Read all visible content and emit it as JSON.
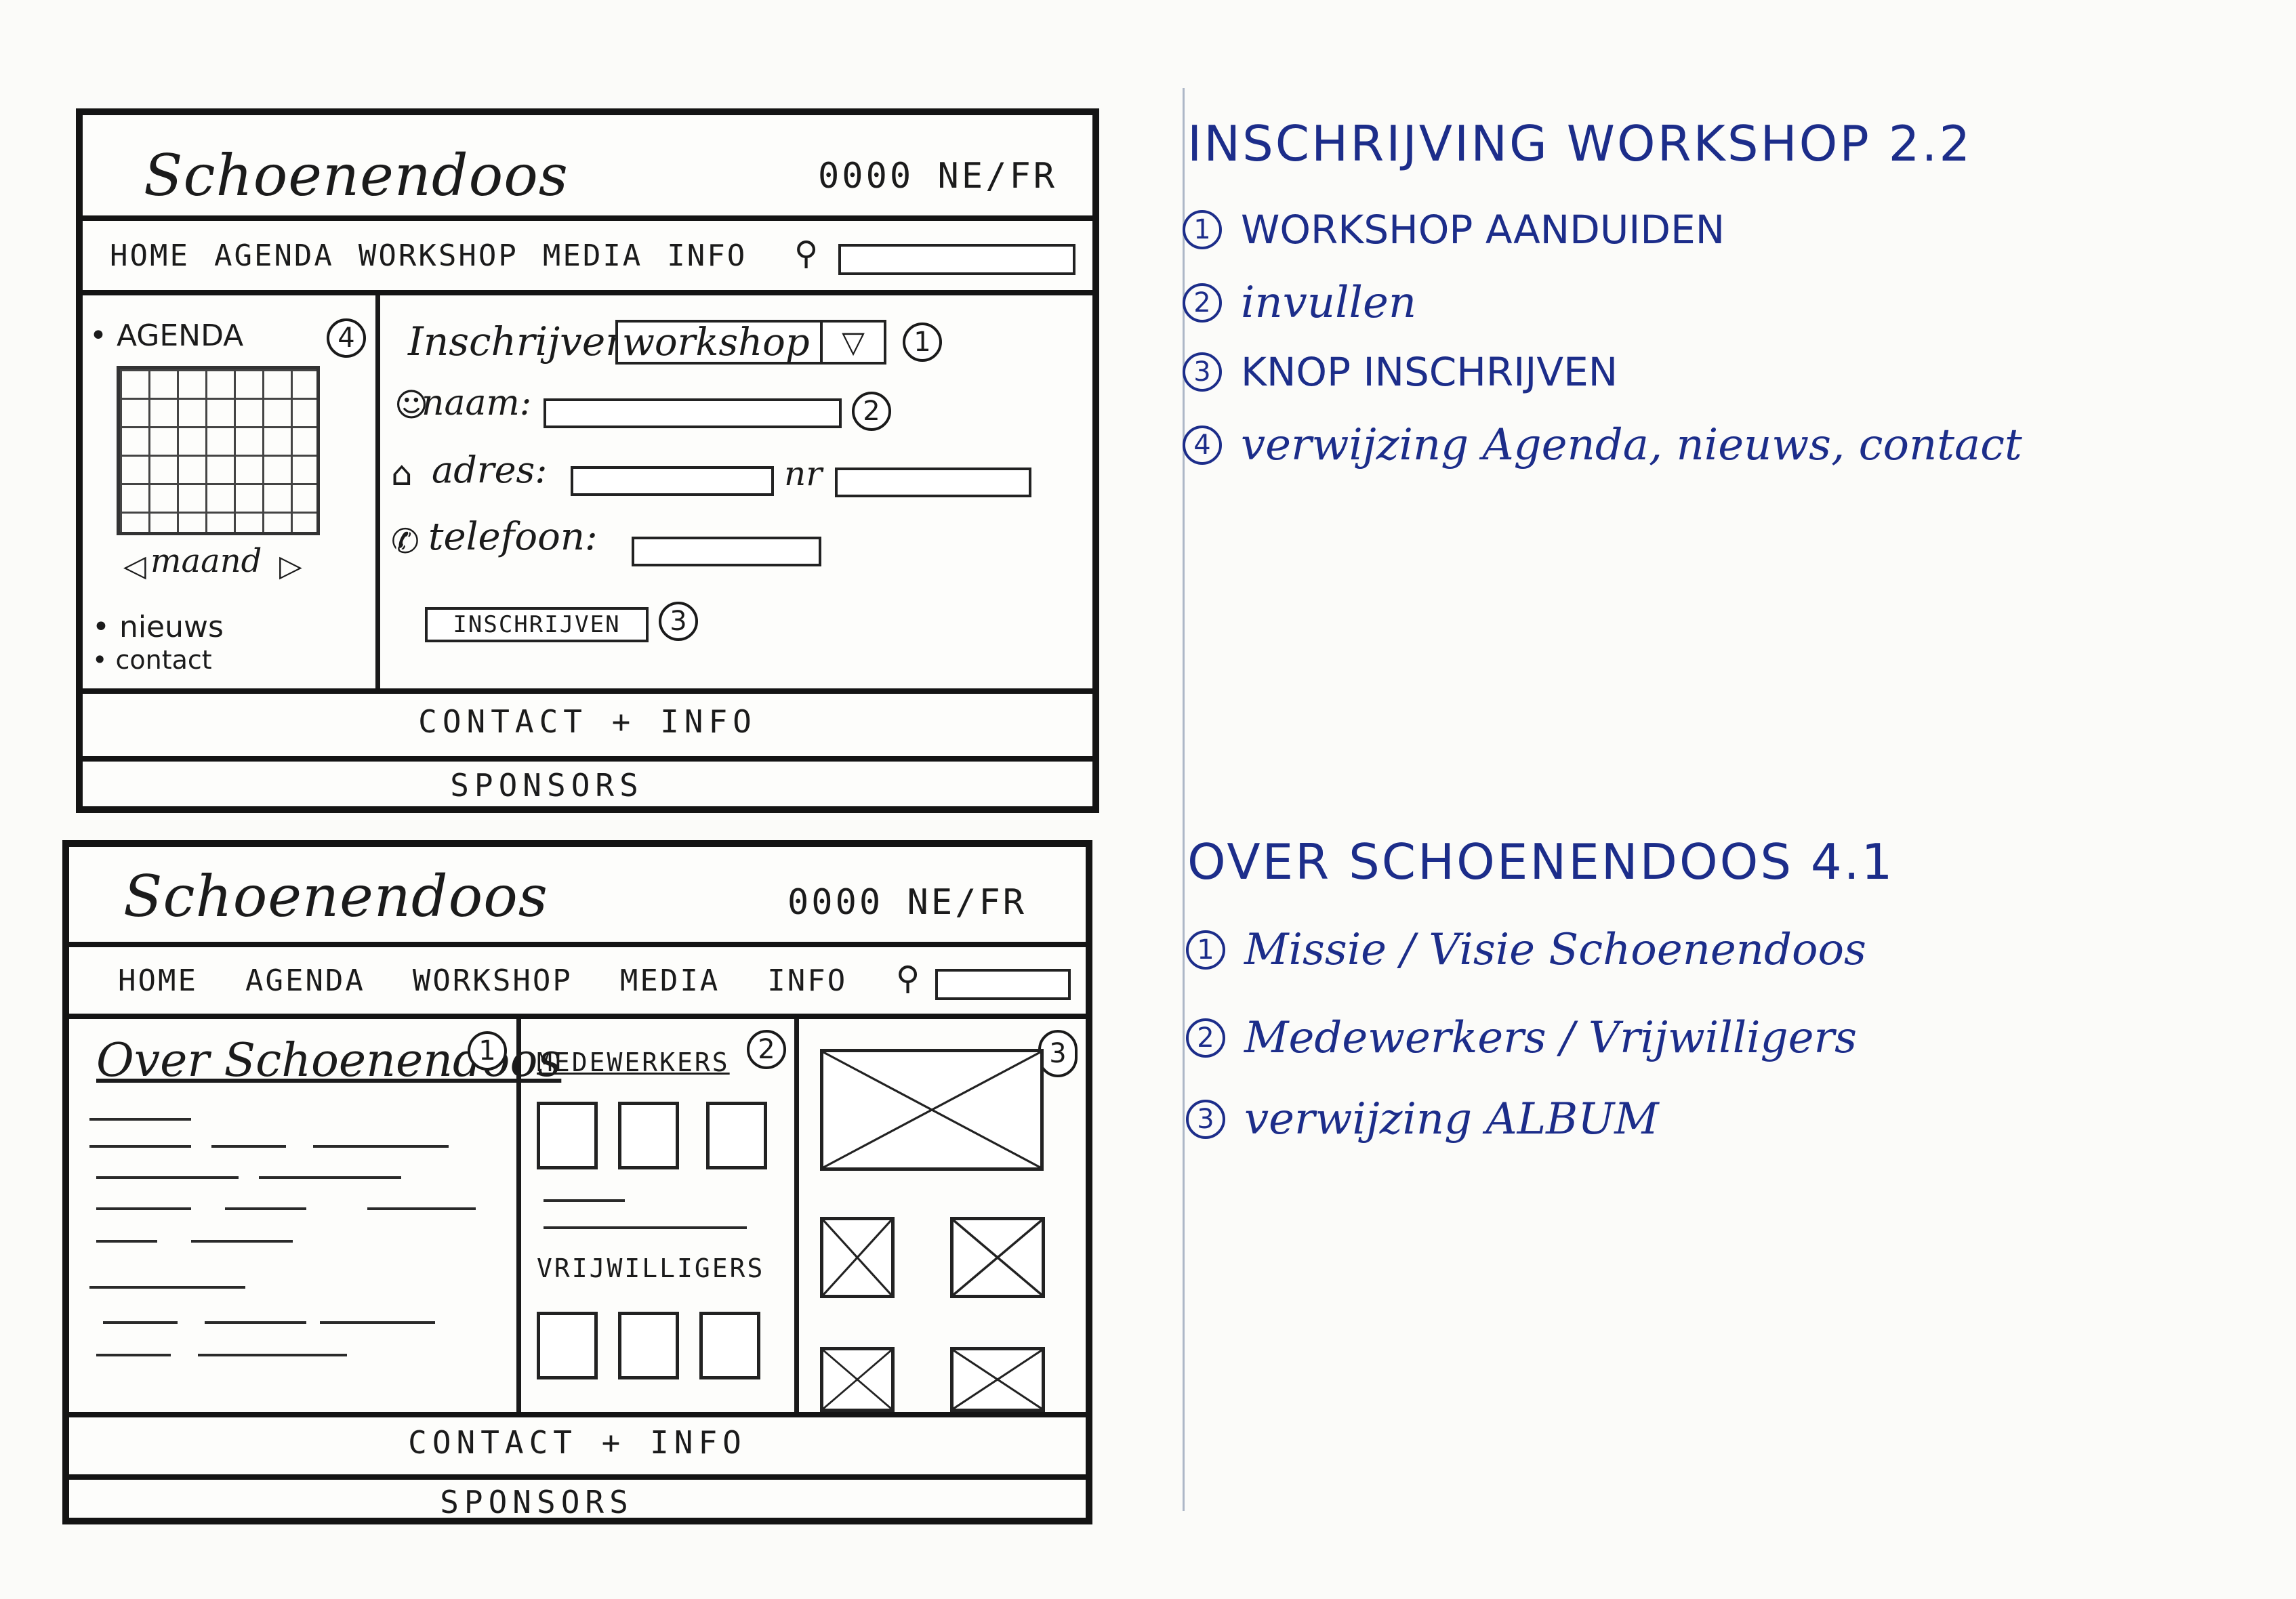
{
  "wireframe_1": {
    "logo": "Schoenendoos",
    "lang": "0000 NE/FR",
    "nav": [
      "HOME",
      "AGENDA",
      "WORKSHOP",
      "MEDIA",
      "INFO"
    ],
    "sidebar": {
      "agenda": "• AGENDA",
      "month_prev": "◁",
      "month_label": "maand",
      "month_next": "▷",
      "nieuws": "• nieuws",
      "contact": "• contact",
      "marker": "4"
    },
    "form": {
      "label": "Inschrijven",
      "select_value": "workshop",
      "select_arrow": "▽",
      "select_marker": "1",
      "naam_label": "naam:",
      "fields_marker": "2",
      "adres_label": "adres:",
      "nr_label": "nr",
      "telefoon_label": "telefoon:",
      "button": "INSCHRIJVEN",
      "button_marker": "3"
    },
    "footer_contact": "CONTACT + INFO",
    "footer_sponsors": "SPONSORS"
  },
  "wireframe_2": {
    "logo": "Schoenendoos",
    "lang": "0000 NE/FR",
    "nav": [
      "HOME",
      "AGENDA",
      "WORKSHOP",
      "MEDIA",
      "INFO"
    ],
    "about_title": "Over Schoenendoos",
    "about_marker": "1",
    "medewerkers": "MEDEWERKERS",
    "team_marker": "2",
    "vrijwilligers": "VRIJWILLIGERS",
    "album_marker": "3",
    "footer_contact": "CONTACT + INFO",
    "footer_sponsors": "SPONSORS"
  },
  "notes_1": {
    "title": "INSCHRIJVING WORKSHOP 2.2",
    "items": [
      {
        "num": "1",
        "text": "WORKSHOP AANDUIDEN"
      },
      {
        "num": "2",
        "text": "invullen"
      },
      {
        "num": "3",
        "text": "KNOP INSCHRIJVEN"
      },
      {
        "num": "4",
        "text": "verwijzing Agenda, nieuws, contact"
      }
    ]
  },
  "notes_2": {
    "title": "OVER SCHOENENDOOS 4.1",
    "items": [
      {
        "num": "1",
        "text": "Missie / Visie Schoenendoos"
      },
      {
        "num": "2",
        "text": "Medewerkers / Vrijwilligers"
      },
      {
        "num": "3",
        "text": "verwijzing ALBUM"
      }
    ]
  },
  "colors": {
    "ink": "#141414",
    "pen_blue": "#1c2d8a",
    "paper": "#fbfbf9"
  }
}
